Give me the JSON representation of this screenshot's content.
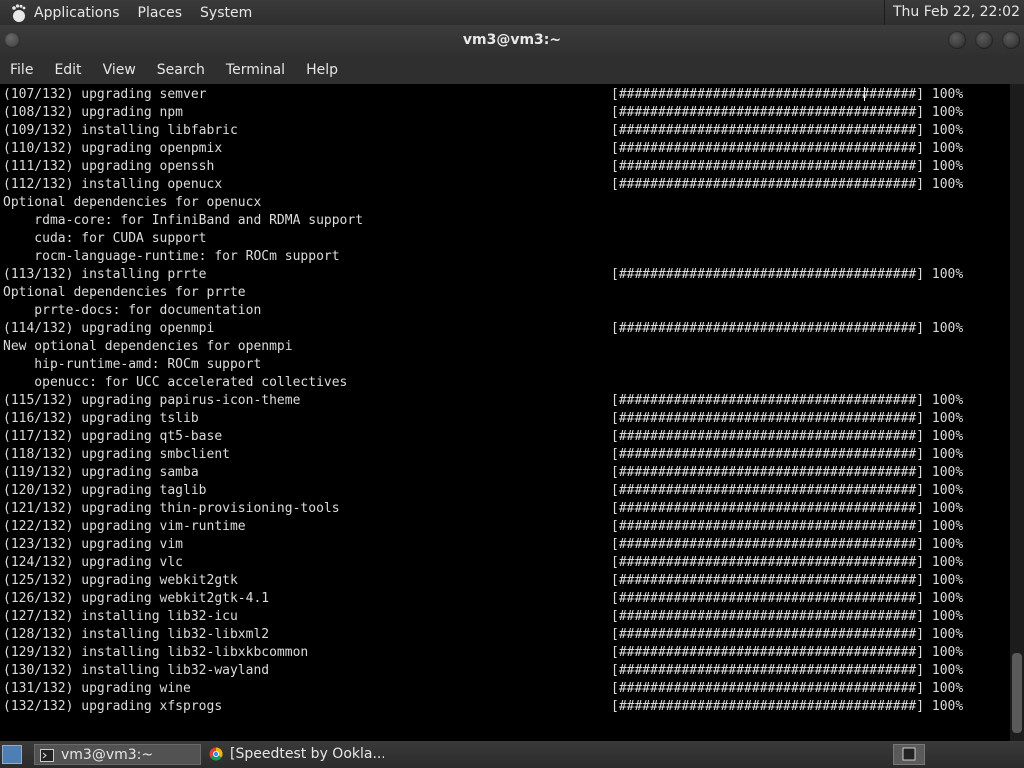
{
  "top_panel": {
    "menus": [
      "Applications",
      "Places",
      "System"
    ],
    "clock": "Thu Feb 22, 22:02"
  },
  "window": {
    "title": "vm3@vm3:~"
  },
  "menubar": [
    "File",
    "Edit",
    "View",
    "Search",
    "Terminal",
    "Help"
  ],
  "terminal": {
    "lines": [
      {
        "text": "(107/132) upgrading semver",
        "bar": "[######################################] 100%"
      },
      {
        "text": "(108/132) upgrading npm",
        "bar": "[######################################] 100%"
      },
      {
        "text": "(109/132) installing libfabric",
        "bar": "[######################################] 100%"
      },
      {
        "text": "(110/132) upgrading openpmix",
        "bar": "[######################################] 100%"
      },
      {
        "text": "(111/132) upgrading openssh",
        "bar": "[######################################] 100%"
      },
      {
        "text": "(112/132) installing openucx",
        "bar": "[######################################] 100%"
      },
      {
        "text": "Optional dependencies for openucx",
        "bar": ""
      },
      {
        "text": "    rdma-core: for InfiniBand and RDMA support",
        "bar": ""
      },
      {
        "text": "    cuda: for CUDA support",
        "bar": ""
      },
      {
        "text": "    rocm-language-runtime: for ROCm support",
        "bar": ""
      },
      {
        "text": "(113/132) installing prrte",
        "bar": "[######################################] 100%"
      },
      {
        "text": "Optional dependencies for prrte",
        "bar": ""
      },
      {
        "text": "    prrte-docs: for documentation",
        "bar": ""
      },
      {
        "text": "(114/132) upgrading openmpi",
        "bar": "[######################################] 100%"
      },
      {
        "text": "New optional dependencies for openmpi",
        "bar": ""
      },
      {
        "text": "    hip-runtime-amd: ROCm support",
        "bar": ""
      },
      {
        "text": "    openucc: for UCC accelerated collectives",
        "bar": ""
      },
      {
        "text": "(115/132) upgrading papirus-icon-theme",
        "bar": "[######################################] 100%"
      },
      {
        "text": "(116/132) upgrading tslib",
        "bar": "[######################################] 100%"
      },
      {
        "text": "(117/132) upgrading qt5-base",
        "bar": "[######################################] 100%"
      },
      {
        "text": "(118/132) upgrading smbclient",
        "bar": "[######################################] 100%"
      },
      {
        "text": "(119/132) upgrading samba",
        "bar": "[######################################] 100%"
      },
      {
        "text": "(120/132) upgrading taglib",
        "bar": "[######################################] 100%"
      },
      {
        "text": "(121/132) upgrading thin-provisioning-tools",
        "bar": "[######################################] 100%"
      },
      {
        "text": "(122/132) upgrading vim-runtime",
        "bar": "[######################################] 100%"
      },
      {
        "text": "(123/132) upgrading vim",
        "bar": "[######################################] 100%"
      },
      {
        "text": "(124/132) upgrading vlc",
        "bar": "[######################################] 100%"
      },
      {
        "text": "(125/132) upgrading webkit2gtk",
        "bar": "[######################################] 100%"
      },
      {
        "text": "(126/132) upgrading webkit2gtk-4.1",
        "bar": "[######################################] 100%"
      },
      {
        "text": "(127/132) installing lib32-icu",
        "bar": "[######################################] 100%"
      },
      {
        "text": "(128/132) installing lib32-libxml2",
        "bar": "[######################################] 100%"
      },
      {
        "text": "(129/132) installing lib32-libxkbcommon",
        "bar": "[######################################] 100%"
      },
      {
        "text": "(130/132) installing lib32-wayland",
        "bar": "[######################################] 100%"
      },
      {
        "text": "(131/132) upgrading wine",
        "bar": "[######################################] 100%"
      },
      {
        "text": "(132/132) upgrading xfsprogs",
        "bar": "[######################################] 100%"
      }
    ]
  },
  "taskbar": {
    "tasks": [
      {
        "label": "vm3@vm3:~",
        "icon": "terminal-icon"
      },
      {
        "label": "[Speedtest by Ookla...",
        "icon": "chrome-icon"
      }
    ]
  }
}
